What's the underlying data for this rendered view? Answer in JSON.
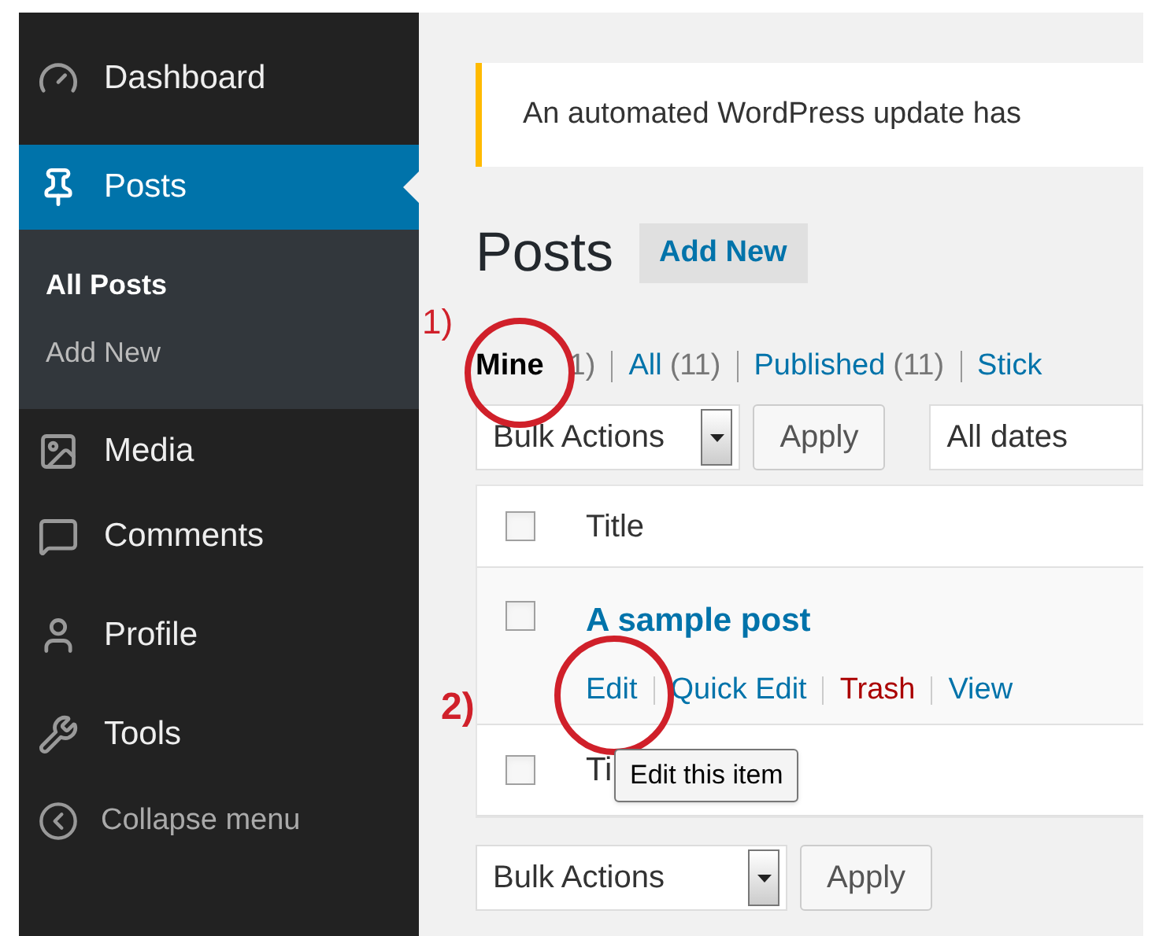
{
  "sidebar": {
    "items": [
      {
        "label": "Dashboard",
        "selected": false
      },
      {
        "label": "Posts",
        "selected": true,
        "children": [
          {
            "label": "All Posts",
            "selected": true
          },
          {
            "label": "Add New",
            "selected": false
          }
        ]
      },
      {
        "label": "Media",
        "selected": false
      },
      {
        "label": "Comments",
        "selected": false
      },
      {
        "label": "Profile",
        "selected": false
      },
      {
        "label": "Tools",
        "selected": false
      }
    ],
    "collapse": "Collapse menu"
  },
  "notice": {
    "text": "An automated WordPress update has"
  },
  "page_title": "Posts",
  "add_new_button": "Add New",
  "filters": [
    {
      "label": "Mine",
      "count": "1)",
      "selected": true
    },
    {
      "label": "All",
      "count": "(11)",
      "selected": false
    },
    {
      "label": "Published",
      "count": "(11)",
      "selected": false
    },
    {
      "label": "Stick",
      "selected": false
    }
  ],
  "top_actions": {
    "bulk_actions": "Bulk Actions",
    "apply": "Apply",
    "date_filter": "All dates"
  },
  "table": {
    "columns": [
      "Title"
    ],
    "header_checked": false,
    "rows": [
      {
        "title": "A sample post",
        "checked": false,
        "actions": [
          {
            "label": "Edit",
            "kind": "link"
          },
          {
            "label": "Quick Edit",
            "kind": "link"
          },
          {
            "label": "Trash",
            "kind": "danger"
          },
          {
            "label": "View",
            "kind": "link"
          }
        ]
      },
      {
        "title": "Ti",
        "checked": false
      }
    ]
  },
  "tooltip": "Edit this item",
  "bottom_actions": {
    "bulk_actions": "Bulk Actions",
    "apply": "Apply"
  },
  "annotations": [
    {
      "label": "1)"
    },
    {
      "label": "2)"
    }
  ]
}
